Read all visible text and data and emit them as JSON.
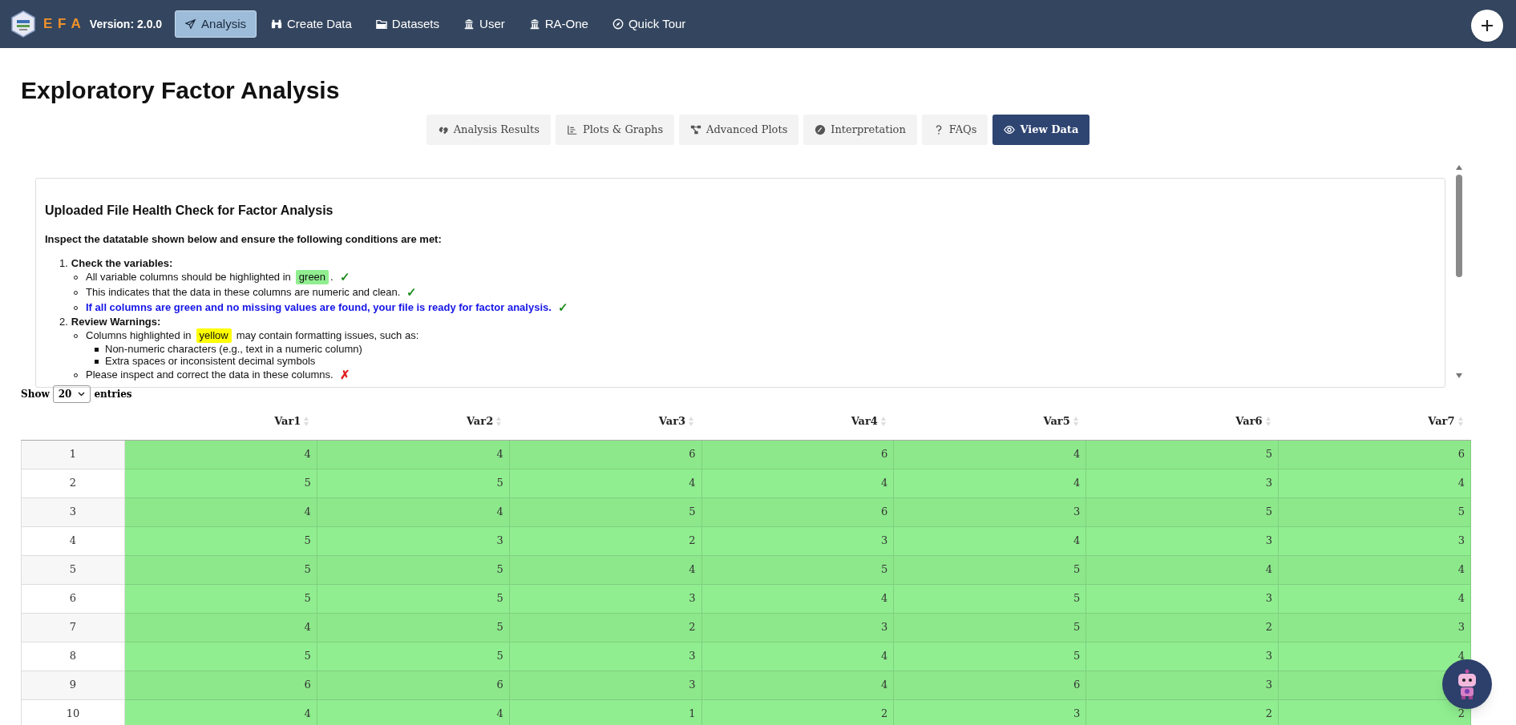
{
  "navbar": {
    "brand": "E F A",
    "version": "Version: 2.0.0",
    "items": [
      {
        "label": "Analysis",
        "kind": "plane",
        "selected": true
      },
      {
        "label": "Create Data",
        "kind": "binoculars",
        "selected": false
      },
      {
        "label": "Datasets",
        "kind": "folder",
        "selected": false
      },
      {
        "label": "User",
        "kind": "building",
        "selected": false
      },
      {
        "label": "RA-One",
        "kind": "building",
        "selected": false
      },
      {
        "label": "Quick Tour",
        "kind": "compass",
        "selected": false
      }
    ]
  },
  "page_title": "Exploratory Factor Analysis",
  "tabs": [
    {
      "label": "Analysis Results",
      "kind": "hands",
      "selected": false
    },
    {
      "label": "Plots & Graphs",
      "kind": "chart",
      "selected": false
    },
    {
      "label": "Advanced Plots",
      "kind": "nodes",
      "selected": false
    },
    {
      "label": "Interpretation",
      "kind": "gauge",
      "selected": false
    },
    {
      "label": "FAQs",
      "kind": "question",
      "selected": false
    },
    {
      "label": "View Data",
      "kind": "eye",
      "selected": true
    }
  ],
  "health_check": {
    "title": "Uploaded File Health Check for Factor Analysis",
    "intro": "Inspect the datatable shown below and ensure the following conditions are met:",
    "steps": [
      {
        "number": "1.",
        "heading": "Check the variables:",
        "points": [
          {
            "kind": "highlight",
            "before": "All variable columns should be highlighted in",
            "highlight": "green",
            "color": "#90ee90",
            "after": ".",
            "mark": "✓"
          },
          {
            "kind": "plain",
            "text": "This indicates that the data in these columns are numeric and clean.",
            "mark": "✓"
          },
          {
            "kind": "emphasis",
            "text": "If all columns are green and no missing values are found, your file is ready for factor analysis.",
            "mark": "✓"
          }
        ]
      },
      {
        "number": "2.",
        "heading": "Review Warnings:",
        "points": [
          {
            "kind": "highlight",
            "before": "Columns highlighted in",
            "highlight": "yellow",
            "color": "#ffff00",
            "after": "may contain formatting issues, such as:",
            "children": [
              "Non-numeric characters (e.g., text in a numeric column)",
              "Extra spaces or inconsistent decimal symbols"
            ]
          },
          {
            "kind": "plain",
            "text": "Please inspect and correct the data in these columns.",
            "mark": "✗"
          }
        ]
      }
    ]
  },
  "table": {
    "length_label_before": "Show",
    "length_value": "20",
    "length_label_after": "entries",
    "columns": [
      "Var1",
      "Var2",
      "Var3",
      "Var4",
      "Var5",
      "Var6",
      "Var7"
    ],
    "rows": [
      {
        "index": "1",
        "cells": [
          "4",
          "4",
          "6",
          "6",
          "4",
          "5",
          "6"
        ]
      },
      {
        "index": "2",
        "cells": [
          "5",
          "5",
          "4",
          "4",
          "4",
          "3",
          "4"
        ]
      },
      {
        "index": "3",
        "cells": [
          "4",
          "4",
          "5",
          "6",
          "3",
          "5",
          "5"
        ]
      },
      {
        "index": "4",
        "cells": [
          "5",
          "3",
          "2",
          "3",
          "4",
          "3",
          "3"
        ]
      },
      {
        "index": "5",
        "cells": [
          "5",
          "5",
          "4",
          "5",
          "5",
          "4",
          "4"
        ]
      },
      {
        "index": "6",
        "cells": [
          "5",
          "5",
          "3",
          "4",
          "5",
          "3",
          "4"
        ]
      },
      {
        "index": "7",
        "cells": [
          "4",
          "5",
          "2",
          "3",
          "5",
          "2",
          "3"
        ]
      },
      {
        "index": "8",
        "cells": [
          "5",
          "5",
          "3",
          "4",
          "5",
          "3",
          "4"
        ]
      },
      {
        "index": "9",
        "cells": [
          "6",
          "6",
          "3",
          "4",
          "6",
          "3",
          null
        ]
      },
      {
        "index": "10",
        "cells": [
          "4",
          "4",
          "1",
          "2",
          "3",
          "2",
          "2"
        ]
      }
    ]
  }
}
